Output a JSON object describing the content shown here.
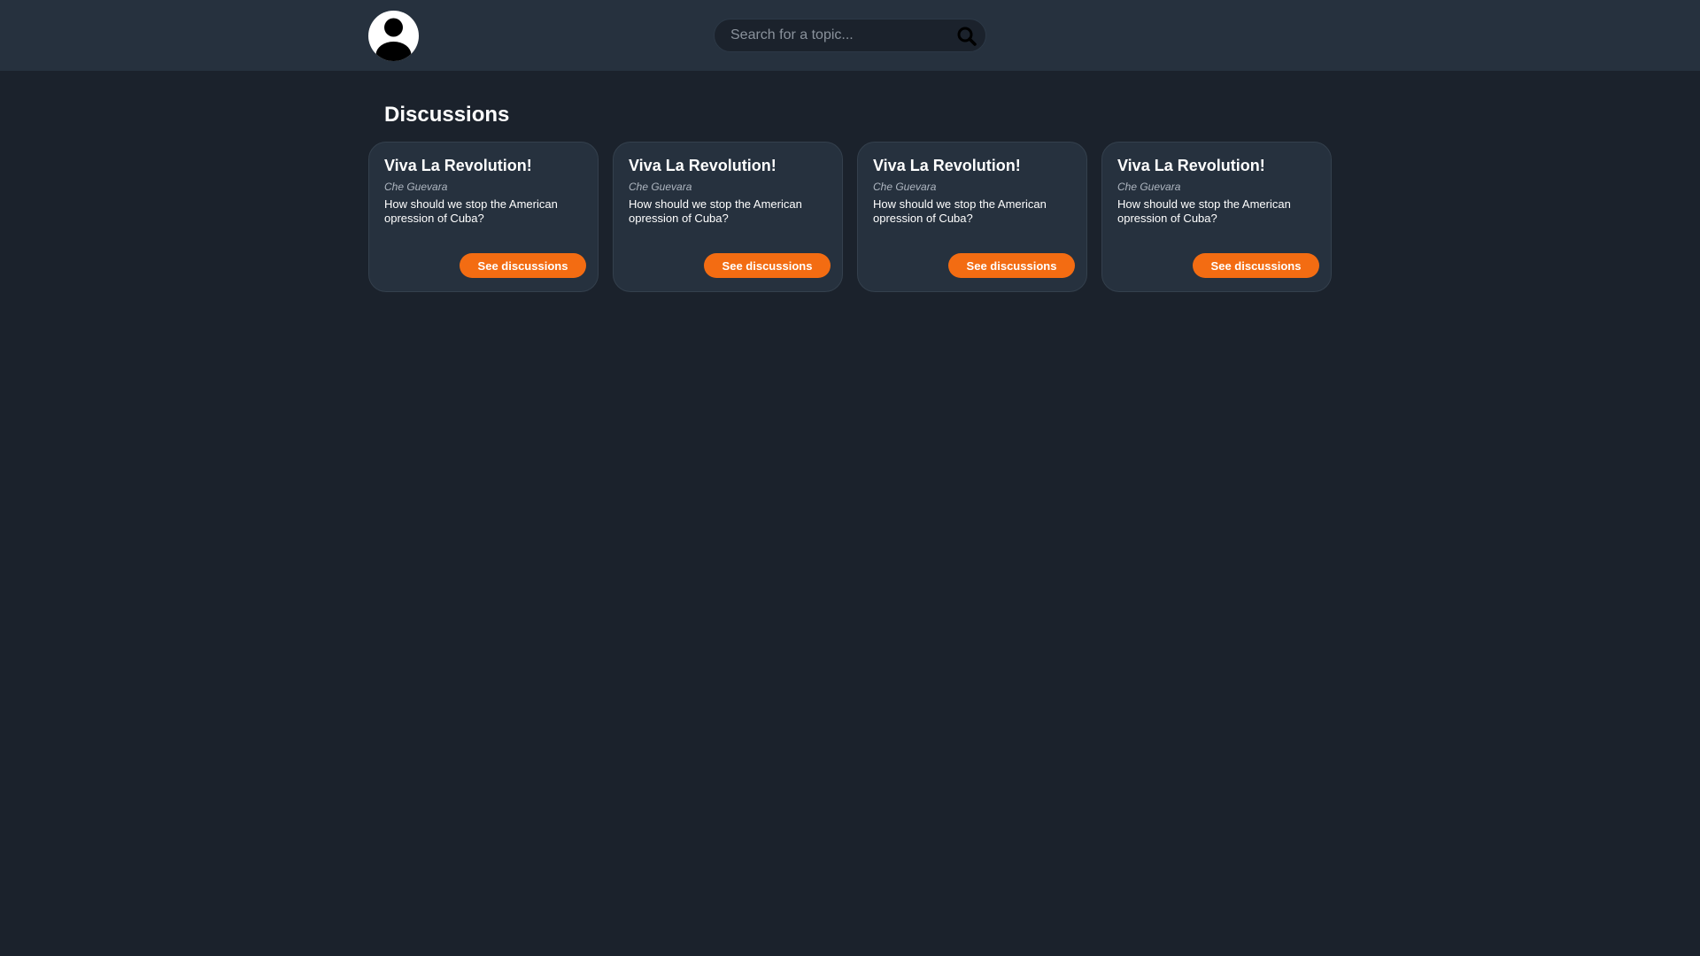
{
  "header": {
    "avatar_icon": "user-avatar-icon",
    "search": {
      "placeholder": "Search for a topic...",
      "value": "",
      "icon": "search-icon"
    }
  },
  "colors": {
    "background": "#1b222c",
    "header_bg": "#26313e",
    "card_bg": "#26313e",
    "accent": "#f36c12"
  },
  "main": {
    "title": "Discussions",
    "cards": [
      {
        "title": "Viva La Revolution!",
        "author": "Che Guevara",
        "description": "How should we stop the American opression of Cuba?",
        "button": "See discussions"
      },
      {
        "title": "Viva La Revolution!",
        "author": "Che Guevara",
        "description": "How should we stop the American opression of Cuba?",
        "button": "See discussions"
      },
      {
        "title": "Viva La Revolution!",
        "author": "Che Guevara",
        "description": "How should we stop the American opression of Cuba?",
        "button": "See discussions"
      },
      {
        "title": "Viva La Revolution!",
        "author": "Che Guevara",
        "description": "How should we stop the American opression of Cuba?",
        "button": "See discussions"
      }
    ]
  }
}
